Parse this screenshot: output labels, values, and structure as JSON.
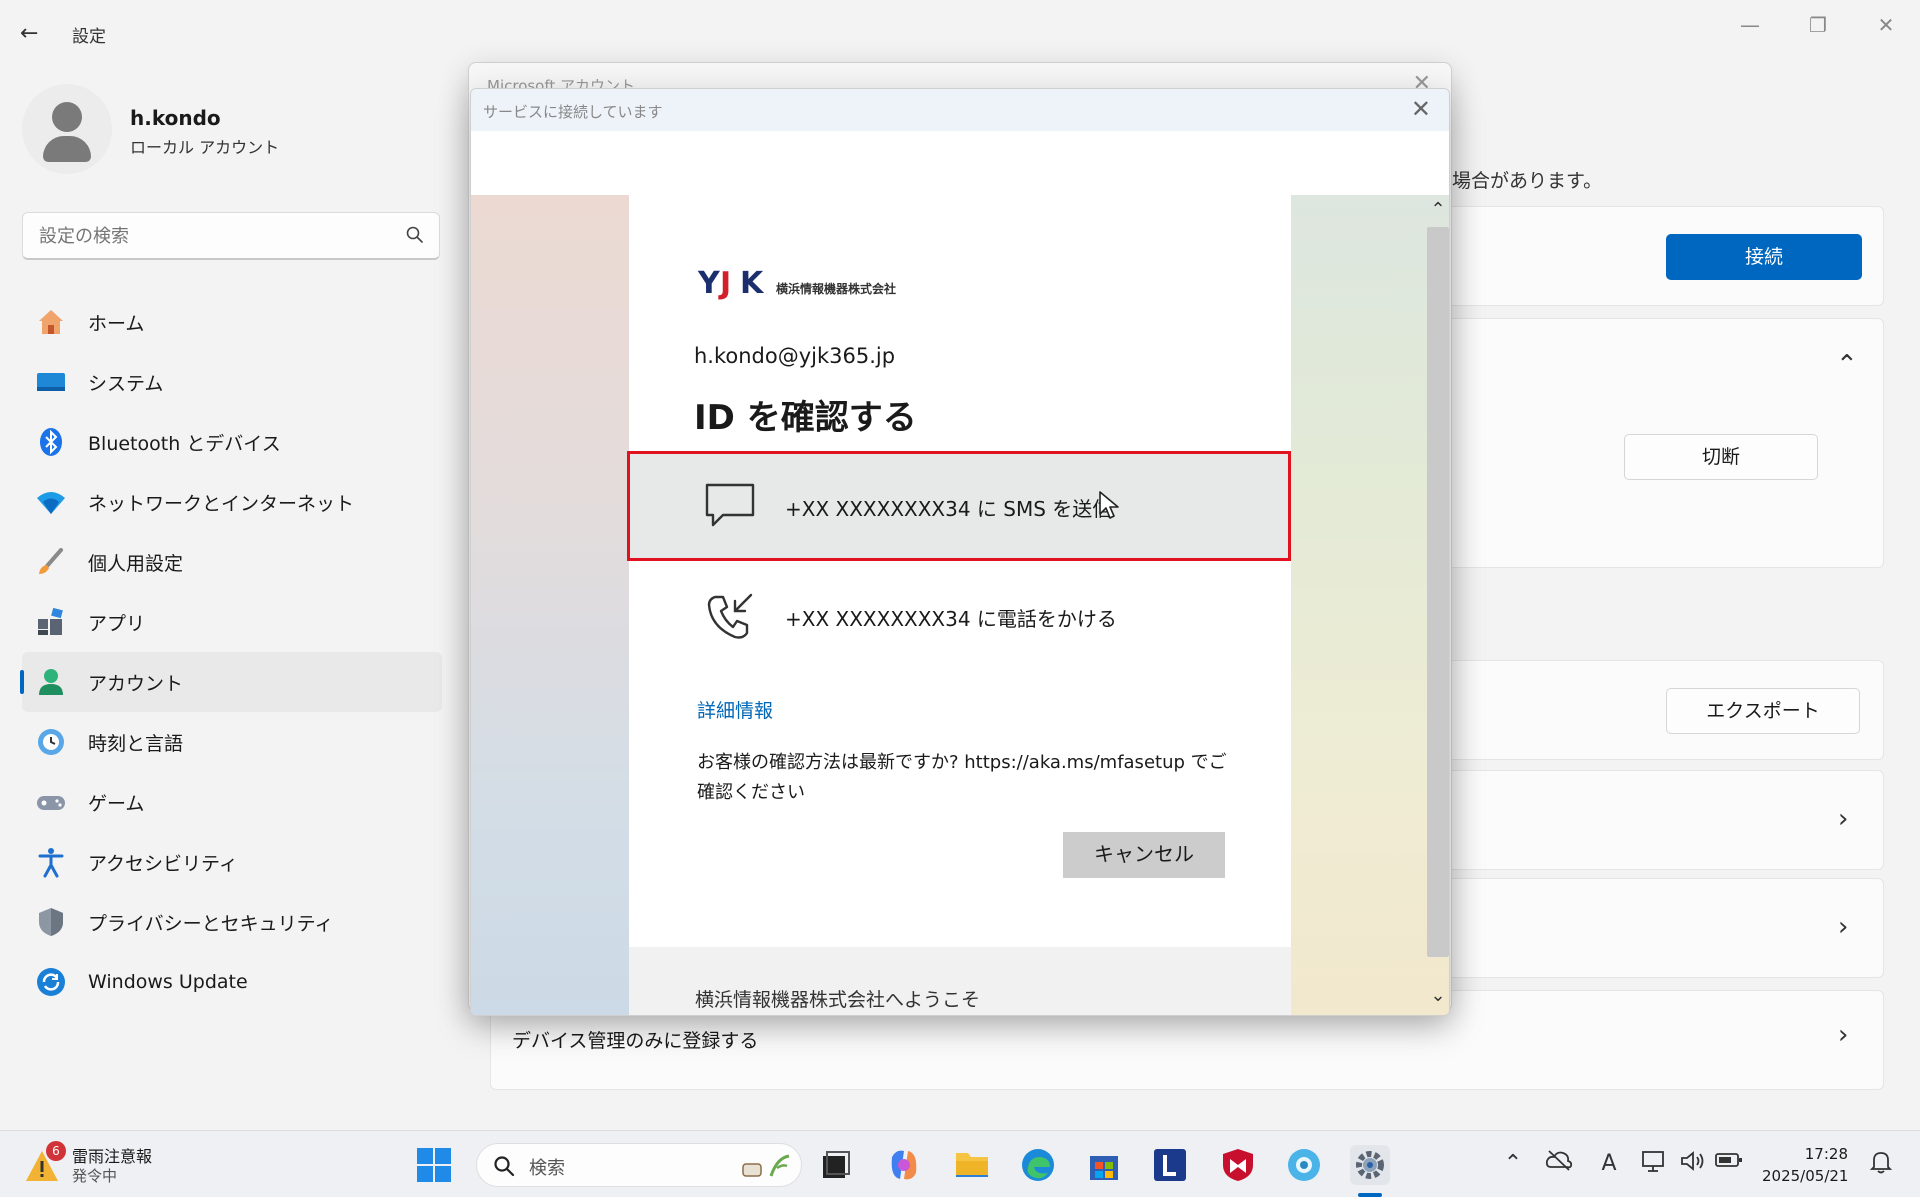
{
  "window": {
    "title": "設定"
  },
  "user": {
    "name": "h.kondo",
    "account_type": "ローカル アカウント"
  },
  "search": {
    "placeholder": "設定の検索"
  },
  "nav": {
    "items": [
      {
        "label": "ホーム",
        "icon": "home-icon"
      },
      {
        "label": "システム",
        "icon": "system-icon"
      },
      {
        "label": "Bluetooth とデバイス",
        "icon": "bluetooth-icon"
      },
      {
        "label": "ネットワークとインターネット",
        "icon": "wifi-icon"
      },
      {
        "label": "個人用設定",
        "icon": "brush-icon"
      },
      {
        "label": "アプリ",
        "icon": "apps-icon"
      },
      {
        "label": "アカウント",
        "icon": "account-icon",
        "active": true
      },
      {
        "label": "時刻と言語",
        "icon": "clock-globe-icon"
      },
      {
        "label": "ゲーム",
        "icon": "gamepad-icon"
      },
      {
        "label": "アクセシビリティ",
        "icon": "accessibility-icon"
      },
      {
        "label": "プライバシーとセキュリティ",
        "icon": "shield-icon"
      },
      {
        "label": "Windows Update",
        "icon": "update-icon"
      }
    ]
  },
  "content": {
    "hint_text": "場合があります。",
    "connect_label": "接続",
    "disconnect_label": "切断",
    "export_label": "エクスポート",
    "device_mgmt_label": "デバイス管理のみに登録する"
  },
  "back_dialog": {
    "title": "Microsoft アカウント"
  },
  "dialog": {
    "title": "サービスに接続しています",
    "company_name": "横浜情報機器株式会社",
    "email": "h.kondo@yjk365.jp",
    "heading": "ID を確認する",
    "option_sms": "+XX XXXXXXXX34 に SMS を送信",
    "option_call": "+XX XXXXXXXX34 に電話をかける",
    "detail_link": "詳細情報",
    "info_text": "お客様の確認方法は最新ですか? https://aka.ms/mfasetup でご確認ください",
    "cancel_label": "キャンセル",
    "footer_text": "横浜情報機器株式会社へようこそ"
  },
  "taskbar": {
    "weather_badge": "6",
    "weather_title": "雷雨注意報",
    "weather_sub": "発令中",
    "search_label": "検索",
    "time": "17:28",
    "date": "2025/05/21"
  },
  "colors": {
    "accent": "#0067c0",
    "highlight_border": "#e0121f",
    "link": "#0067b8"
  }
}
